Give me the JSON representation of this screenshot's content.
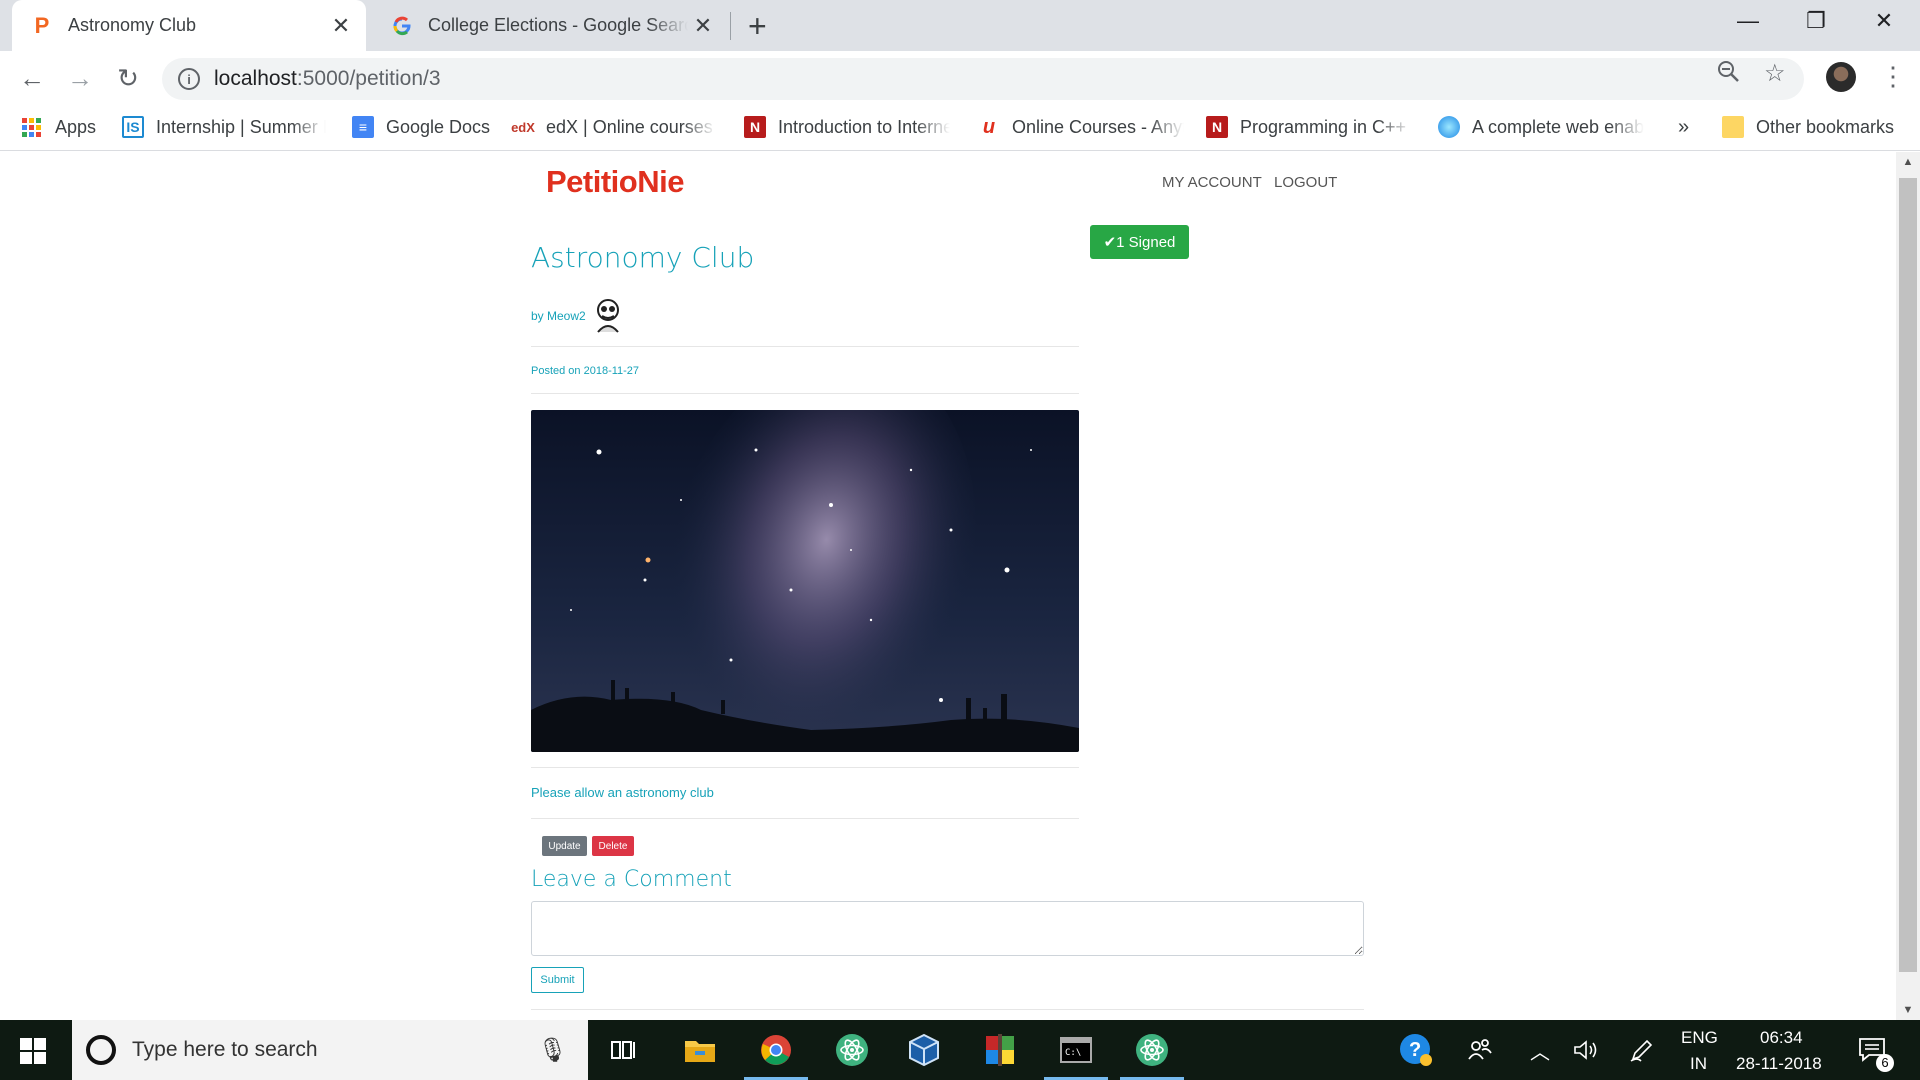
{
  "browser": {
    "tabs": [
      {
        "title": "Astronomy Club",
        "favicon": "petitionie-p-icon"
      },
      {
        "title": "College Elections - Google Search",
        "favicon": "google-g-icon"
      }
    ],
    "url_host": "localhost",
    "url_rest": ":5000/petition/3",
    "bookmarks": [
      {
        "label": "Apps"
      },
      {
        "label": "Internship | Summer Internship"
      },
      {
        "label": "Google Docs"
      },
      {
        "label": "edX | Online courses from the world's best"
      },
      {
        "label": "Introduction to Internet"
      },
      {
        "label": "Online Courses - Anytime"
      },
      {
        "label": "Programming in C++"
      },
      {
        "label": "A complete web enabled"
      },
      {
        "label": "Other bookmarks"
      }
    ],
    "more_bookmarks": "»"
  },
  "site": {
    "brand": "PetitioNie",
    "nav": {
      "account": "MY ACCOUNT",
      "logout": "LOGOUT"
    }
  },
  "petition": {
    "signed_label": "✔1 Signed",
    "title": "Astronomy Club",
    "author": "by Meow2",
    "posted": "Posted on 2018-11-27",
    "description": "Please allow an astronomy club",
    "update_label": "Update",
    "delete_label": "Delete"
  },
  "comment": {
    "heading": "Leave a Comment",
    "value": "",
    "submit_label": "Submit"
  },
  "taskbar": {
    "search_placeholder": "Type here to search",
    "lang_top": "ENG",
    "lang_bottom": "IN",
    "time": "06:34",
    "date": "28-11-2018",
    "notifications": "6"
  },
  "colors": {
    "accent": "#17a2b8",
    "brand": "#e0301e",
    "success": "#28a745",
    "danger": "#dc3545",
    "secondary": "#6c757d"
  }
}
